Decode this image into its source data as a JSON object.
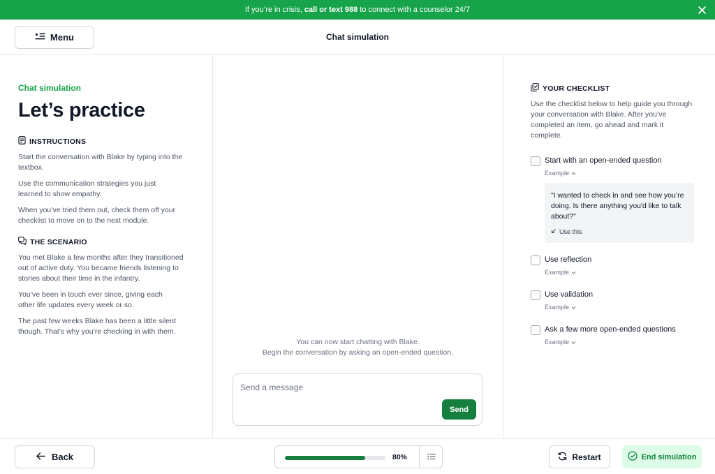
{
  "banner": {
    "prefix": "If you’re in crisis, ",
    "highlight": "call or text 988",
    "suffix": " to connect with a counselor 24/7"
  },
  "header": {
    "menu_label": "Menu",
    "title": "Chat simulation"
  },
  "left": {
    "kicker": "Chat simulation",
    "title": "Let’s practice",
    "instructions": {
      "heading": "INSTRUCTIONS",
      "paragraphs": [
        "Start the conversation with Blake by typing into the textbox.",
        "Use the communication strategies you just learned to show empathy.",
        "When you’ve tried them out, check them off your checklist to move on to the next module."
      ]
    },
    "scenario": {
      "heading": "THE SCENARIO",
      "paragraphs": [
        "You met Blake a few months after they transitioned out of active duty. You became friends listening to stories about their time in the infantry.",
        "You’ve been in touch ever since, giving each other life updates every week or so.",
        "The past few weeks Blake has been a little silent though. That’s why you’re checking in with them."
      ]
    }
  },
  "chat": {
    "start_line1": "You can now start chatting with Blake.",
    "start_line2": "Begin the conversation by asking an open-ended question.",
    "input_placeholder": "Send a message",
    "send_label": "Send"
  },
  "checklist": {
    "heading": "YOUR CHECKLIST",
    "description": "Use the checklist below to help guide you through your conversation with Blake. After you’ve completed an item, go ahead and mark it complete.",
    "items": [
      {
        "label": "Start with an open-ended question",
        "example_label": "Example",
        "expanded": true,
        "example_text": "\"I wanted to check in and see how you’re doing. Is there anything you'd like to talk about?\"",
        "use_this": "Use this"
      },
      {
        "label": "Use reflection",
        "example_label": "Example",
        "expanded": false
      },
      {
        "label": "Use validation",
        "example_label": "Example",
        "expanded": false
      },
      {
        "label": "Ask a few more open-ended questions",
        "example_label": "Example",
        "expanded": false
      }
    ]
  },
  "footer": {
    "back_label": "Back",
    "progress_value": 0.8,
    "progress_text": "80%",
    "restart_label": "Restart",
    "end_label": "End simulation"
  },
  "colors": {
    "accent": "#16a34a",
    "accent_dark": "#15803d",
    "accent_light": "#dcfce7"
  }
}
